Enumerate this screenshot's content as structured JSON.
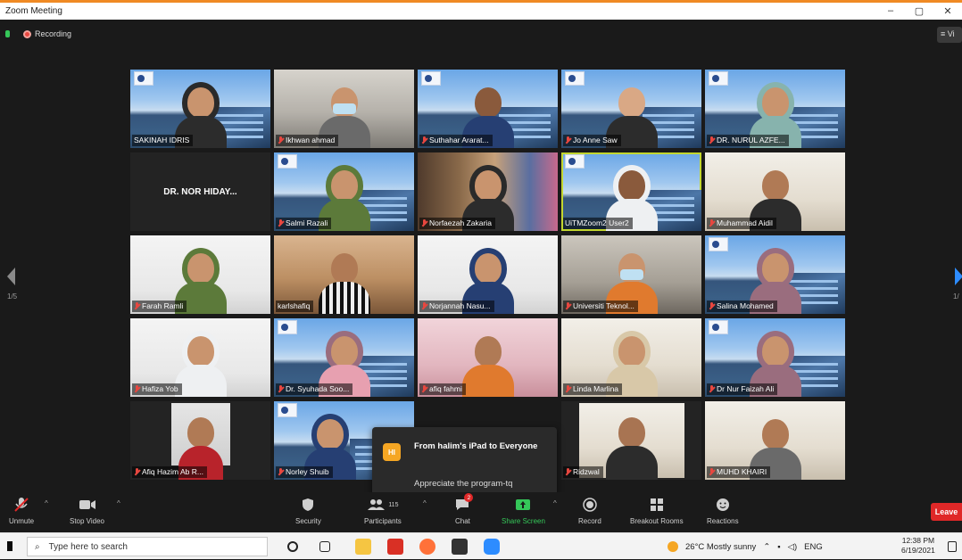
{
  "window": {
    "title": "Zoom Meeting",
    "controls": [
      "–",
      "▢",
      "✕"
    ]
  },
  "meeting": {
    "recording_label": "Recording",
    "view_label": "≡ Vi",
    "page_left": "1/5",
    "page_right": "1/"
  },
  "tiles": [
    {
      "name": "SAKINAH IDRIS",
      "muted": false
    },
    {
      "name": "Ikhwan ahmad",
      "muted": true
    },
    {
      "name": "Suthahar Ararat...",
      "muted": true
    },
    {
      "name": "Jo Anne Saw",
      "muted": true
    },
    {
      "name": "DR. NURUL AZFE...",
      "muted": true
    },
    {
      "name": "DR. NOR HIDAY...",
      "muted": true
    },
    {
      "name": "Salmi Razali",
      "muted": true
    },
    {
      "name": "Norfaezah Zakaria",
      "muted": true
    },
    {
      "name": "UiTMZoom2 User2",
      "muted": false
    },
    {
      "name": "Muhammad Aidil",
      "muted": true
    },
    {
      "name": "Farah Ramli",
      "muted": true
    },
    {
      "name": "karlshafiq",
      "muted": false
    },
    {
      "name": "Norjannah Nasu...",
      "muted": true
    },
    {
      "name": "Universiti Teknol...",
      "muted": true
    },
    {
      "name": "Salina Mohamed",
      "muted": true
    },
    {
      "name": "Hafiza Yob",
      "muted": true
    },
    {
      "name": "Dr. Syuhada Soo...",
      "muted": true
    },
    {
      "name": "afiq fahmi",
      "muted": true
    },
    {
      "name": "Linda Marlina",
      "muted": true
    },
    {
      "name": "Dr Nur Faizah Ali",
      "muted": true
    },
    {
      "name": "Afiq Hazim Ab R...",
      "muted": true
    },
    {
      "name": "Norley Shuib",
      "muted": true
    },
    {
      "name": "Ridzwal",
      "muted": true
    },
    {
      "name": "MUHD KHAIRI",
      "muted": true
    }
  ],
  "chat_toast": {
    "badge": "HI",
    "from": "From halim's iPad to Everyone",
    "message": "Appreciate the program-tq"
  },
  "toolbar": {
    "unmute": "Unmute",
    "stop_video": "Stop Video",
    "security": "Security",
    "participants": "Participants",
    "participants_count": "115",
    "chat": "Chat",
    "chat_badge": "2",
    "share_screen": "Share Screen",
    "record": "Record",
    "breakout_rooms": "Breakout Rooms",
    "reactions": "Reactions",
    "leave": "Leave"
  },
  "taskbar": {
    "search_placeholder": "Type here to search",
    "weather": "26°C  Mostly sunny",
    "lang": "ENG",
    "time": "12:38 PM",
    "date": "6/19/2021"
  },
  "colors": {
    "zoom_blue": "#2d8cff",
    "record_red": "#e8473f",
    "share_green": "#35c759",
    "leave_red": "#e02828",
    "active_speaker": "#c3d62f"
  }
}
